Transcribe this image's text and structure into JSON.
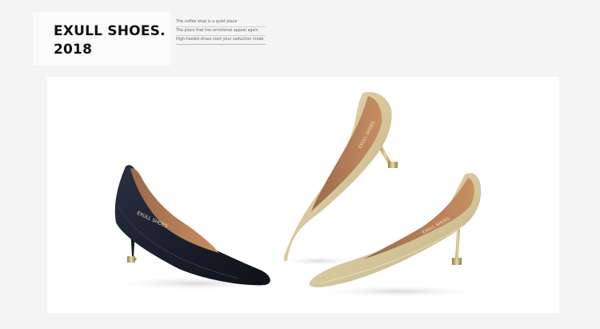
{
  "title": {
    "line1": "EXULL SHOES.",
    "line2": "2018"
  },
  "taglines": [
    "The coffee shop is a quiet place",
    "The place that has emotional appeal again",
    "High-heeled shoes start your seduction mode"
  ],
  "shoe_insole_texts": [
    "EXULL SHOES",
    "EXULL SHOES",
    "EXULL SHOES"
  ],
  "colors": {
    "background": "#f4f4f4",
    "photo_background": "#ffffff",
    "black_shoe": "#1c2130",
    "gold_shoe": "#d9cba2",
    "lining": "#b57c55"
  },
  "icons": [
    "black-pump-shoe-icon",
    "gold-pump-shoe-icon"
  ]
}
